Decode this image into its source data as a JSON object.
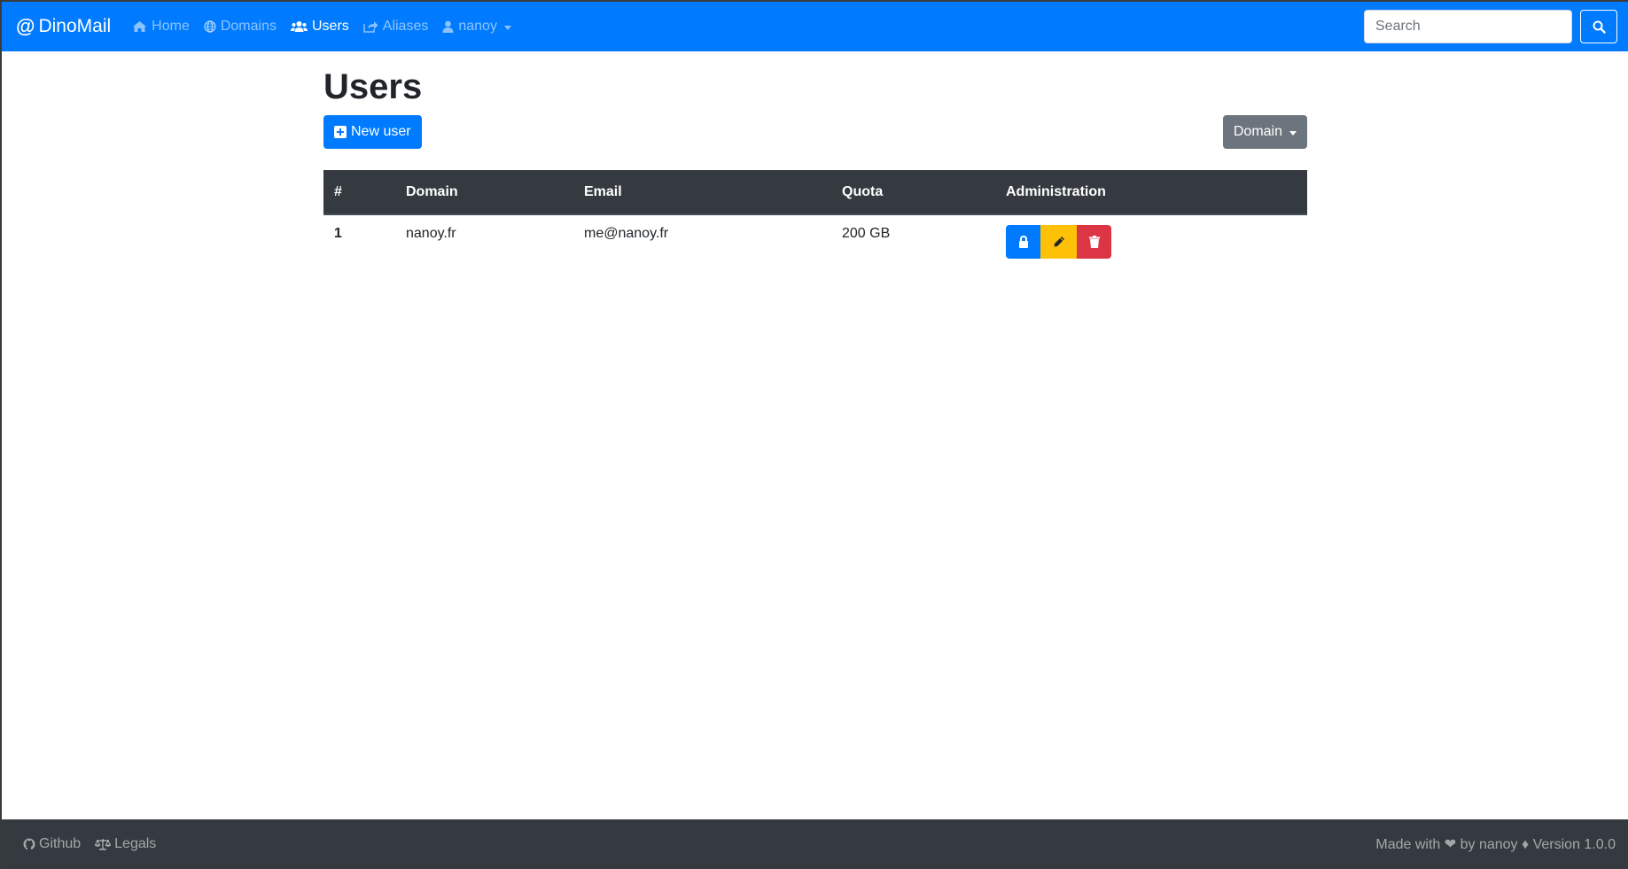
{
  "navbar": {
    "brand_symbol": "@",
    "brand_name": "DinoMail",
    "items": [
      {
        "label": "Home",
        "icon": "home-icon"
      },
      {
        "label": "Domains",
        "icon": "globe-icon"
      },
      {
        "label": "Users",
        "icon": "users-icon",
        "active": true
      },
      {
        "label": "Aliases",
        "icon": "share-icon"
      }
    ],
    "user_menu": {
      "label": "nanoy",
      "icon": "user-icon"
    },
    "search": {
      "placeholder": "Search",
      "value": "",
      "button_icon": "search-icon"
    }
  },
  "main": {
    "title": "Users",
    "new_button_label": "New user",
    "new_button_icon": "plus-square-icon",
    "filter_button_label": "Domain",
    "table": {
      "headers": [
        "#",
        "Domain",
        "Email",
        "Quota",
        "Administration"
      ],
      "rows": [
        {
          "num": "1",
          "domain": "nanoy.fr",
          "email": "me@nanoy.fr",
          "quota": "200 GB"
        }
      ],
      "actions": [
        "lock-icon",
        "pencil-icon",
        "trash-icon"
      ]
    }
  },
  "footer": {
    "links": [
      {
        "label": "Github",
        "icon": "github-icon"
      },
      {
        "label": "Legals",
        "icon": "balance-scale-icon"
      }
    ],
    "credit": "Made with ❤ by nanoy ♦ Version 1.0.0"
  },
  "colors": {
    "primary": "#007bff",
    "secondary": "#6c757d",
    "warning": "#ffc107",
    "danger": "#dc3545",
    "dark": "#343a40"
  }
}
